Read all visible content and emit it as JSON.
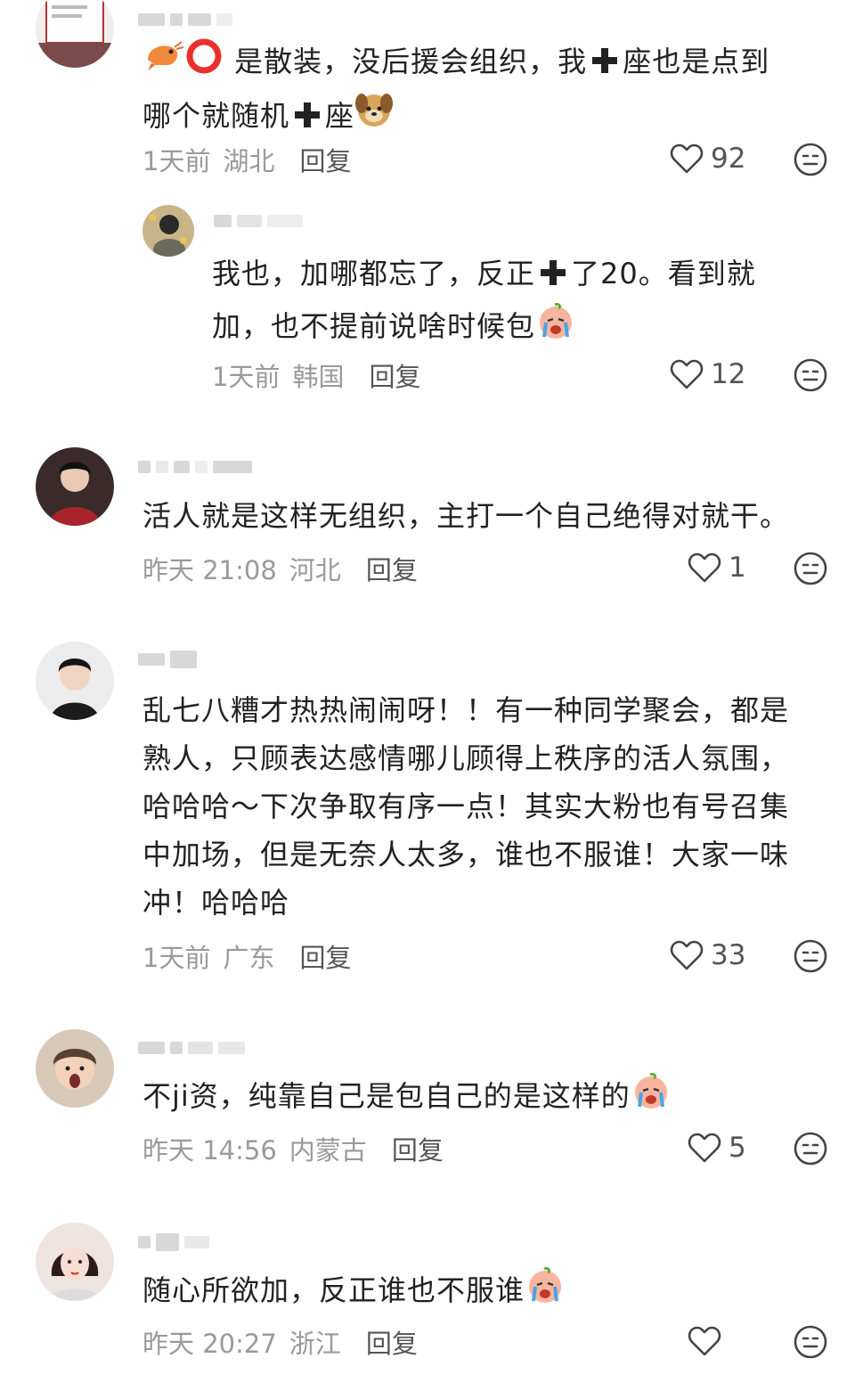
{
  "comments": [
    {
      "text_a": "是散装，没后援会组织，我",
      "text_b": "座也是点到",
      "text_c": "哪个就随机",
      "text_d": "座",
      "time": "1天前",
      "region": "湖北",
      "reply": "回复",
      "likes": "92"
    },
    {
      "text_a": "我也，加哪都忘了，反正",
      "text_b": "了20。看到就",
      "text_c": "加，也不提前说啥时候包",
      "time": "1天前",
      "region": "韩国",
      "reply": "回复",
      "likes": "12"
    },
    {
      "text": "活人就是这样无组织，主打一个自己绝得对就干。",
      "time": "昨天 21:08",
      "region": "河北",
      "reply": "回复",
      "likes": "1"
    },
    {
      "lines": [
        "乱七八糟才热热闹闹呀！！有一种同学聚会，都是",
        "熟人，只顾表达感情哪儿顾得上秩序的活人氛围，",
        "哈哈哈～下次争取有序一点！其实大粉也有号召集",
        "中加场，但是无奈人太多，谁也不服谁！大家一味",
        "冲！哈哈哈"
      ],
      "time": "1天前",
      "region": "广东",
      "reply": "回复",
      "likes": "33"
    },
    {
      "text": "不ji资，纯靠自己是包自己的是这样的",
      "time": "昨天 14:56",
      "region": "内蒙古",
      "reply": "回复",
      "likes": "5"
    },
    {
      "text": "随心所欲加，反正谁也不服谁",
      "time": "昨天 20:27",
      "region": "浙江",
      "reply": "回复",
      "likes": ""
    }
  ],
  "icons": {
    "like": "heart-outline-icon",
    "face": "neutral-face-icon",
    "plus": "plus-icon",
    "shrimp": "shrimp-emoji",
    "ring": "red-ring-emoji",
    "dog": "dog-emoji",
    "cry": "crying-emoji"
  },
  "colors": {
    "text": "#222222",
    "meta": "#9a9a9a",
    "reply": "#555555",
    "ring": "#e8312a"
  }
}
